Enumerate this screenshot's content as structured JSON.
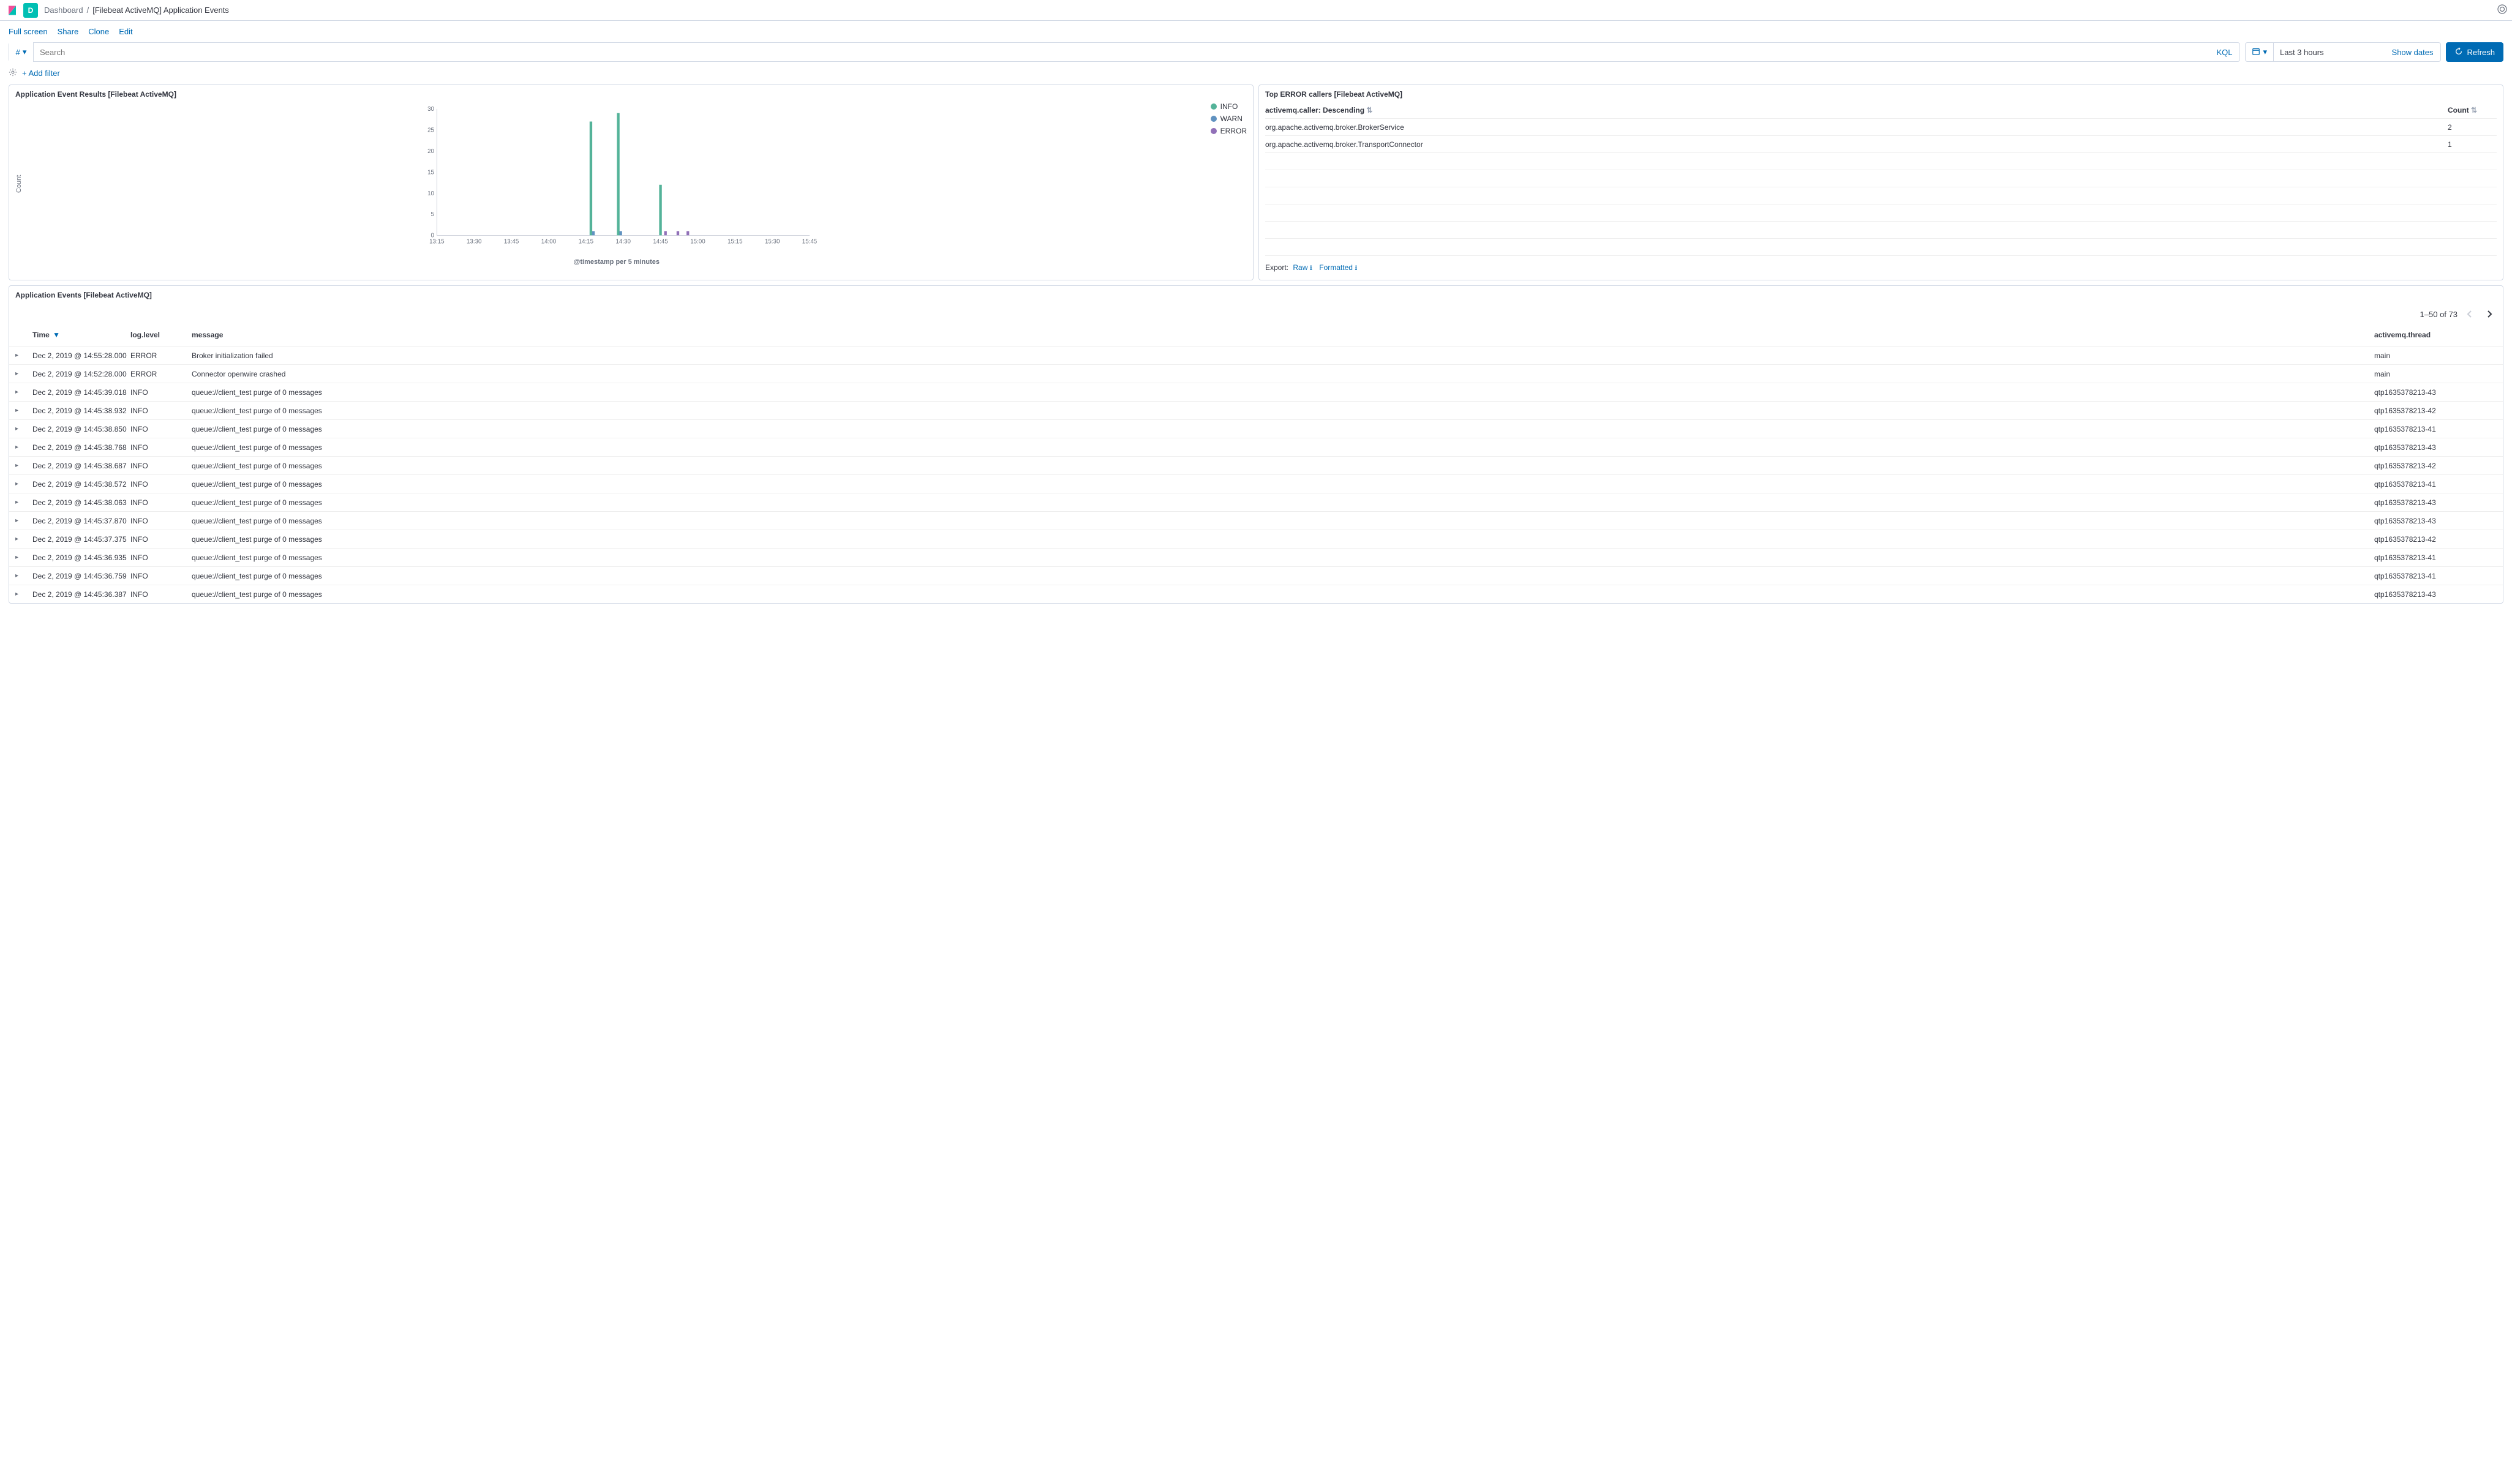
{
  "header": {
    "app_letter": "D",
    "breadcrumb_root": "Dashboard",
    "breadcrumb_current": "[Filebeat ActiveMQ] Application Events"
  },
  "toolbar": {
    "fullscreen": "Full screen",
    "share": "Share",
    "clone": "Clone",
    "edit": "Edit"
  },
  "query": {
    "search_placeholder": "Search",
    "kql_label": "KQL",
    "time_range": "Last 3 hours",
    "show_dates": "Show dates",
    "refresh": "Refresh",
    "add_filter": "+ Add filter"
  },
  "chart_panel": {
    "title": "Application Event Results [Filebeat ActiveMQ]",
    "y_label": "Count",
    "x_label": "@timestamp per 5 minutes",
    "legend": [
      {
        "label": "INFO",
        "color": "#54b399"
      },
      {
        "label": "WARN",
        "color": "#6092c0"
      },
      {
        "label": "ERROR",
        "color": "#9170b8"
      }
    ]
  },
  "chart_data": {
    "type": "bar",
    "categories": [
      "13:15",
      "13:30",
      "13:45",
      "14:00",
      "14:15",
      "14:30",
      "14:45",
      "15:00",
      "15:15",
      "15:30",
      "15:45"
    ],
    "y_ticks": [
      0,
      5,
      10,
      15,
      20,
      25,
      30
    ],
    "ylim": [
      0,
      30
    ],
    "series": [
      {
        "name": "INFO",
        "color": "#54b399",
        "points": [
          {
            "x": "14:17",
            "y": 27
          },
          {
            "x": "14:28",
            "y": 29
          },
          {
            "x": "14:45",
            "y": 12
          }
        ]
      },
      {
        "name": "WARN",
        "color": "#6092c0",
        "points": [
          {
            "x": "14:18",
            "y": 1
          },
          {
            "x": "14:29",
            "y": 1
          }
        ]
      },
      {
        "name": "ERROR",
        "color": "#9170b8",
        "points": [
          {
            "x": "14:47",
            "y": 1
          },
          {
            "x": "14:52",
            "y": 1
          },
          {
            "x": "14:56",
            "y": 1
          }
        ]
      }
    ],
    "xlabel": "@timestamp per 5 minutes",
    "ylabel": "Count"
  },
  "error_panel": {
    "title": "Top ERROR callers [Filebeat ActiveMQ]",
    "columns": {
      "caller": "activemq.caller: Descending",
      "count": "Count"
    },
    "rows": [
      {
        "caller": "org.apache.activemq.broker.BrokerService",
        "count": "2"
      },
      {
        "caller": "org.apache.activemq.broker.TransportConnector",
        "count": "1"
      }
    ],
    "export_label": "Export:",
    "export_raw": "Raw",
    "export_formatted": "Formatted"
  },
  "events_panel": {
    "title": "Application Events [Filebeat ActiveMQ]",
    "page_text": "1–50 of 73",
    "columns": {
      "time": "Time",
      "level": "log.level",
      "message": "message",
      "thread": "activemq.thread"
    },
    "rows": [
      {
        "time": "Dec 2, 2019 @ 14:55:28.000",
        "level": "ERROR",
        "message": "Broker initialization failed",
        "thread": "main"
      },
      {
        "time": "Dec 2, 2019 @ 14:52:28.000",
        "level": "ERROR",
        "message": "Connector openwire crashed",
        "thread": "main"
      },
      {
        "time": "Dec 2, 2019 @ 14:45:39.018",
        "level": "INFO",
        "message": "queue://client_test purge of 0 messages",
        "thread": "qtp1635378213-43"
      },
      {
        "time": "Dec 2, 2019 @ 14:45:38.932",
        "level": "INFO",
        "message": "queue://client_test purge of 0 messages",
        "thread": "qtp1635378213-42"
      },
      {
        "time": "Dec 2, 2019 @ 14:45:38.850",
        "level": "INFO",
        "message": "queue://client_test purge of 0 messages",
        "thread": "qtp1635378213-41"
      },
      {
        "time": "Dec 2, 2019 @ 14:45:38.768",
        "level": "INFO",
        "message": "queue://client_test purge of 0 messages",
        "thread": "qtp1635378213-43"
      },
      {
        "time": "Dec 2, 2019 @ 14:45:38.687",
        "level": "INFO",
        "message": "queue://client_test purge of 0 messages",
        "thread": "qtp1635378213-42"
      },
      {
        "time": "Dec 2, 2019 @ 14:45:38.572",
        "level": "INFO",
        "message": "queue://client_test purge of 0 messages",
        "thread": "qtp1635378213-41"
      },
      {
        "time": "Dec 2, 2019 @ 14:45:38.063",
        "level": "INFO",
        "message": "queue://client_test purge of 0 messages",
        "thread": "qtp1635378213-43"
      },
      {
        "time": "Dec 2, 2019 @ 14:45:37.870",
        "level": "INFO",
        "message": "queue://client_test purge of 0 messages",
        "thread": "qtp1635378213-43"
      },
      {
        "time": "Dec 2, 2019 @ 14:45:37.375",
        "level": "INFO",
        "message": "queue://client_test purge of 0 messages",
        "thread": "qtp1635378213-42"
      },
      {
        "time": "Dec 2, 2019 @ 14:45:36.935",
        "level": "INFO",
        "message": "queue://client_test purge of 0 messages",
        "thread": "qtp1635378213-41"
      },
      {
        "time": "Dec 2, 2019 @ 14:45:36.759",
        "level": "INFO",
        "message": "queue://client_test purge of 0 messages",
        "thread": "qtp1635378213-41"
      },
      {
        "time": "Dec 2, 2019 @ 14:45:36.387",
        "level": "INFO",
        "message": "queue://client_test purge of 0 messages",
        "thread": "qtp1635378213-43"
      }
    ]
  }
}
